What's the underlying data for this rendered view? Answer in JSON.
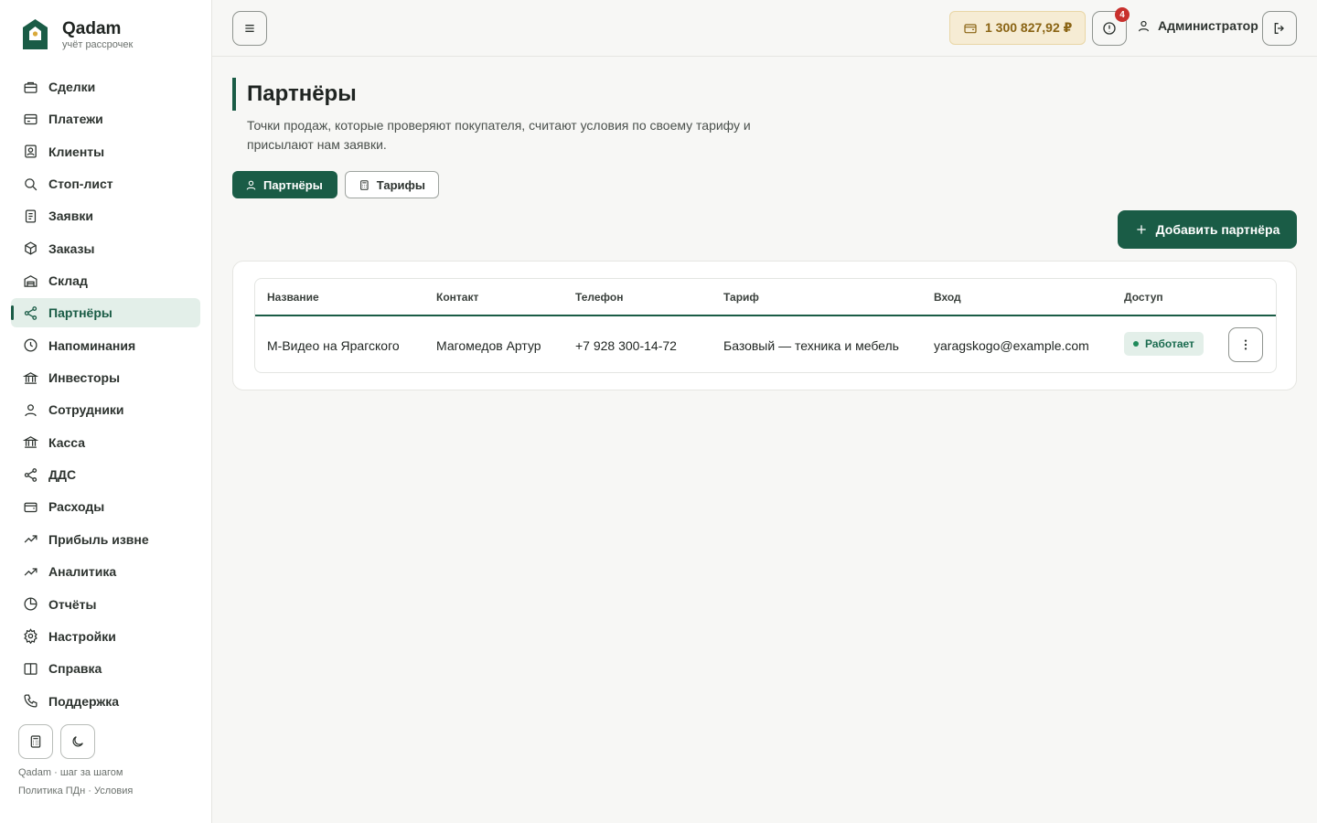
{
  "brand": {
    "name": "Qadam",
    "subtitle": "учёт рассрочек"
  },
  "sidebar": {
    "items": [
      {
        "label": "Сделки",
        "icon": "briefcase-icon"
      },
      {
        "label": "Платежи",
        "icon": "credit-card-icon"
      },
      {
        "label": "Клиенты",
        "icon": "contact-card-icon"
      },
      {
        "label": "Стоп-лист",
        "icon": "search-icon"
      },
      {
        "label": "Заявки",
        "icon": "document-icon"
      },
      {
        "label": "Заказы",
        "icon": "box-icon"
      },
      {
        "label": "Склад",
        "icon": "warehouse-icon"
      },
      {
        "label": "Партнёры",
        "icon": "share-icon",
        "active": true
      },
      {
        "label": "Напоминания",
        "icon": "clock-icon"
      },
      {
        "label": "Инвесторы",
        "icon": "bank-icon"
      },
      {
        "label": "Сотрудники",
        "icon": "user-icon"
      },
      {
        "label": "Касса",
        "icon": "bank-icon"
      },
      {
        "label": "ДДС",
        "icon": "share-icon"
      },
      {
        "label": "Расходы",
        "icon": "wallet-icon"
      },
      {
        "label": "Прибыль извне",
        "icon": "trending-up-icon"
      },
      {
        "label": "Аналитика",
        "icon": "trending-up-icon"
      },
      {
        "label": "Отчёты",
        "icon": "pie-chart-icon"
      },
      {
        "label": "Настройки",
        "icon": "gear-icon"
      },
      {
        "label": "Справка",
        "icon": "book-icon"
      },
      {
        "label": "Поддержка",
        "icon": "phone-icon"
      }
    ],
    "footer_line1": "Qadam · шаг за шагом",
    "footer_line2": "Политика ПДн · Условия"
  },
  "topbar": {
    "balance": "1 300 827,92 ₽",
    "alerts_count": "4",
    "user_name": "Администратор"
  },
  "page": {
    "title": "Партнёры",
    "description": "Точки продаж, которые проверяют покупателя, считают условия по своему тарифу и присылают нам заявки.",
    "tabs": [
      {
        "label": "Партнёры",
        "icon": "user-icon",
        "active": true
      },
      {
        "label": "Тарифы",
        "icon": "calculator-icon",
        "active": false
      }
    ],
    "add_button": "Добавить партнёра"
  },
  "table": {
    "columns": [
      "Название",
      "Контакт",
      "Телефон",
      "Тариф",
      "Вход",
      "Доступ"
    ],
    "rows": [
      {
        "name": "М-Видео на Ярагского",
        "contact": "Магомедов Артур",
        "phone": "+7 928 300-14-72",
        "tariff": "Базовый — техника и мебель",
        "login": "yaragskogo@example.com",
        "access": "Работает"
      }
    ]
  },
  "colors": {
    "accent": "#1a5c46",
    "balance_bg": "#f6ecd4",
    "badge": "#c8302c",
    "active_bg": "#e3efe9"
  }
}
